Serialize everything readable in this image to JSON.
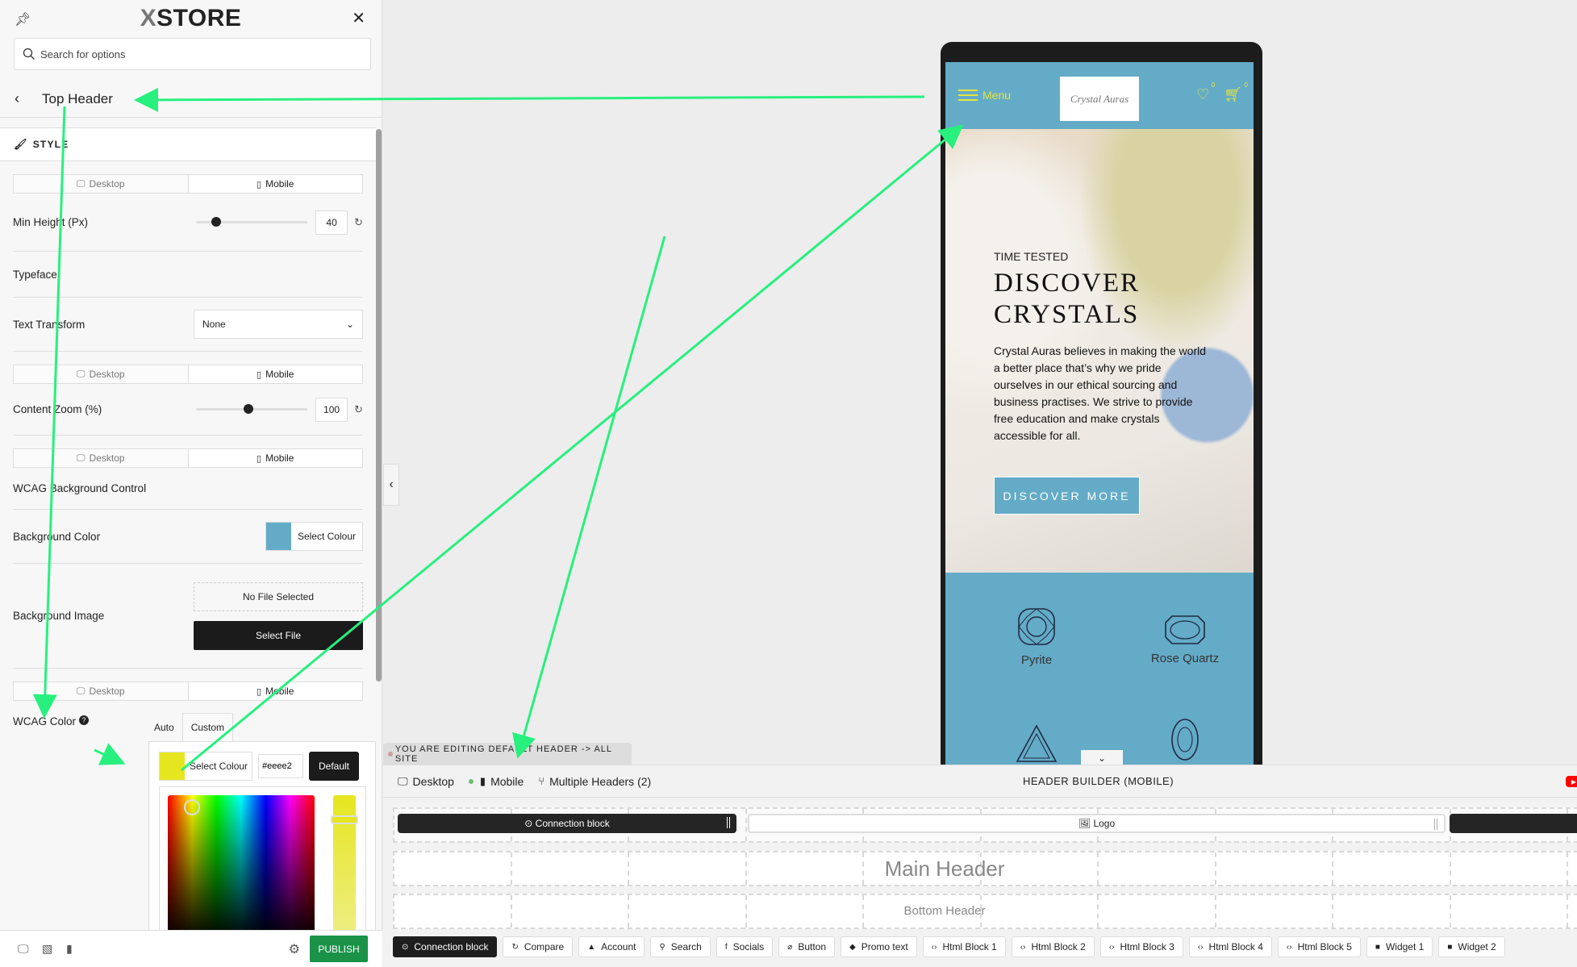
{
  "panel": {
    "logo_prefix": "X",
    "logo_text": "STORE",
    "search_placeholder": "Search for options",
    "section_title": "Top Header",
    "style_heading": "STYLE",
    "device_tabs": {
      "desktop": "Desktop",
      "mobile": "Mobile"
    },
    "min_height": {
      "label": "Min Height (Px)",
      "value": "40",
      "fraction": 0.15
    },
    "typeface_label": "Typeface",
    "text_transform": {
      "label": "Text Transform",
      "value": "None"
    },
    "content_zoom": {
      "label": "Content Zoom (%)",
      "value": "100",
      "fraction": 0.47
    },
    "wcag_bg_label": "WCAG Background Control",
    "background_color": {
      "label": "Background Color",
      "button": "Select Colour",
      "swatch": "#64abc7"
    },
    "background_image": {
      "label": "Background Image",
      "status": "No File Selected",
      "button": "Select File"
    },
    "wcag_color": {
      "label": "WCAG Color",
      "help": "?",
      "tabs": [
        "Auto",
        "Custom"
      ],
      "active_tab": "Custom",
      "button": "Select Colour",
      "swatch": "#e6e61f",
      "hex": "#eeee2",
      "default_button": "Default"
    },
    "publish": "PUBLISH"
  },
  "collapse_icon": "‹",
  "preview": {
    "menu_label": "Menu",
    "logo_text": "Crystal Auras",
    "wishlist_count": "0",
    "cart_count": "0",
    "hero_kicker": "TIME TESTED",
    "hero_title_1": "DISCOVER",
    "hero_title_2": "CRYSTALS",
    "hero_text": "Crystal Auras believes in making the world a better place that’s why we pride ourselves in our ethical sourcing and business practises. We strive to provide free education and make crystals accessible for all.",
    "hero_button": "DISCOVER MORE",
    "crystals": [
      {
        "name": "Pyrite"
      },
      {
        "name": "Rose Quartz"
      }
    ],
    "accent_color": "#e6e63a",
    "brand_color": "#64abc7"
  },
  "builder": {
    "editing_notice": "YOU ARE EDITING DEFAULT HEADER -> ALL SITE",
    "tabs": {
      "desktop": "Desktop",
      "mobile": "Mobile",
      "multiple": "Multiple Headers (2)"
    },
    "title": "HEADER BUILDER (MOBILE)",
    "blocks": {
      "connection": "Connection block",
      "logo": "Logo"
    },
    "rows": {
      "main": "Main Header",
      "bottom": "Bottom Header"
    },
    "elements": [
      {
        "label": "Connection block",
        "icon": "connection"
      },
      {
        "label": "Compare",
        "icon": "compare"
      },
      {
        "label": "Account",
        "icon": "account"
      },
      {
        "label": "Search",
        "icon": "search"
      },
      {
        "label": "Socials",
        "icon": "facebook"
      },
      {
        "label": "Button",
        "icon": "button"
      },
      {
        "label": "Promo text",
        "icon": "megaphone"
      },
      {
        "label": "Html Block 1",
        "icon": "code"
      },
      {
        "label": "Html Block 2",
        "icon": "code"
      },
      {
        "label": "Html Block 3",
        "icon": "code"
      },
      {
        "label": "Html Block 4",
        "icon": "code"
      },
      {
        "label": "Html Block 5",
        "icon": "code"
      },
      {
        "label": "Widget 1",
        "icon": "folder"
      },
      {
        "label": "Widget 2",
        "icon": "folder"
      }
    ]
  }
}
